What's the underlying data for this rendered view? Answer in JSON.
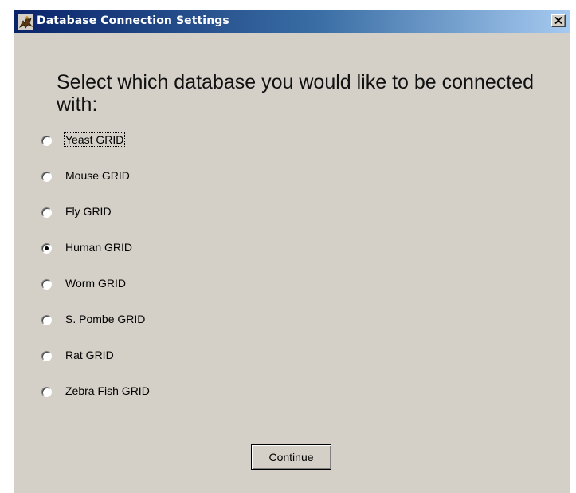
{
  "window": {
    "title": "Database Connection Settings",
    "app_icon": "app-logo-icon",
    "close_icon": "close-icon",
    "titlebar_colors": [
      "#0a246a",
      "#a6caf0"
    ],
    "background_color": "#d4d0c8"
  },
  "prompt": "Select which database you would like to be connected with:",
  "options": [
    {
      "label": "Yeast GRID",
      "checked": false,
      "focused": true
    },
    {
      "label": "Mouse GRID",
      "checked": false,
      "focused": false
    },
    {
      "label": "Fly GRID",
      "checked": false,
      "focused": false
    },
    {
      "label": "Human GRID",
      "checked": true,
      "focused": false
    },
    {
      "label": "Worm GRID",
      "checked": false,
      "focused": false
    },
    {
      "label": "S. Pombe GRID",
      "checked": false,
      "focused": false
    },
    {
      "label": "Rat GRID",
      "checked": false,
      "focused": false
    },
    {
      "label": "Zebra Fish GRID",
      "checked": false,
      "focused": false
    }
  ],
  "continue_label": "Continue"
}
